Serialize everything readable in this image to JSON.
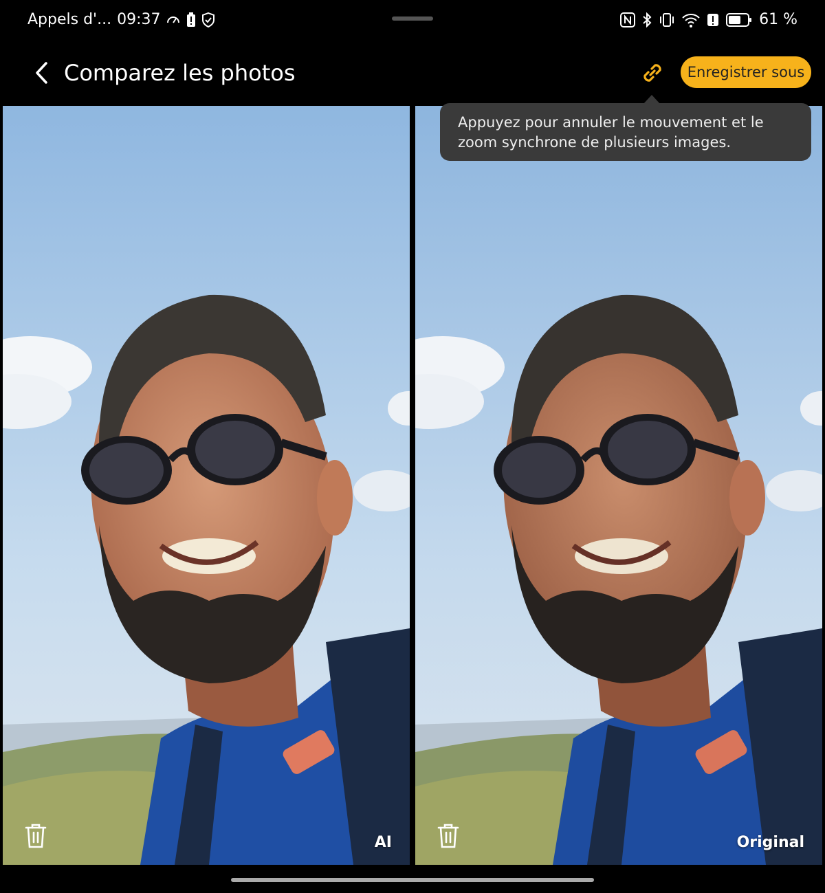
{
  "status_bar": {
    "app_label": "Appels d'...",
    "time": "09:37",
    "battery": "61 %",
    "left_icons": [
      "speedometer-icon",
      "battery-alert-icon",
      "shield-icon"
    ],
    "right_icons": [
      "nfc-icon",
      "bluetooth-icon",
      "vibrate-icon",
      "wifi-icon",
      "alert-icon",
      "battery-icon"
    ]
  },
  "header": {
    "title": "Comparez les photos",
    "save_label": "Enregistrer sous",
    "link_icon": "link-icon",
    "back_icon": "chevron-left-icon"
  },
  "tooltip": {
    "line1": "Appuyez pour annuler le mouvement et le",
    "line2": "zoom synchrone de plusieurs images."
  },
  "panels": [
    {
      "label": "AI",
      "delete_icon": "trash-icon"
    },
    {
      "label": "Original",
      "delete_icon": "trash-icon"
    }
  ],
  "colors": {
    "accent": "#f7b21b",
    "background": "#000000",
    "tooltip_bg": "#3a3a3a"
  }
}
